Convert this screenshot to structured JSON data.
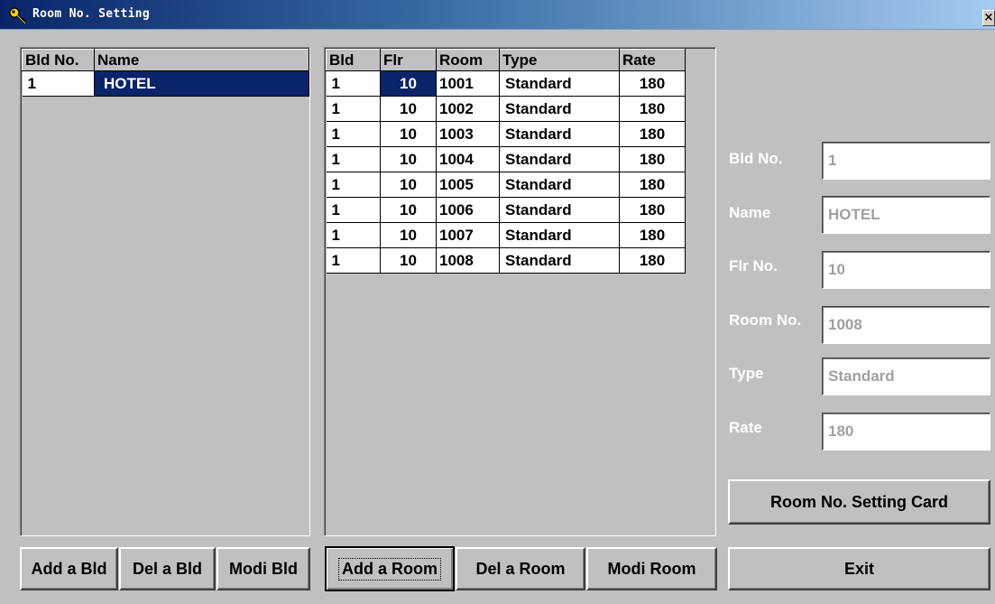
{
  "window": {
    "title": "Room No. Setting",
    "close_glyph": "×",
    "icon": "key-icon"
  },
  "buildings": {
    "columns": [
      "Bld No.",
      "Name"
    ],
    "rows": [
      {
        "bld_no": "1",
        "name": "HOTEL"
      }
    ]
  },
  "rooms": {
    "columns": [
      "Bld",
      "Flr",
      "Room",
      "Type",
      "Rate"
    ],
    "rows": [
      {
        "bld": "1",
        "flr": "10",
        "room": "1001",
        "type": "Standard",
        "rate": "180"
      },
      {
        "bld": "1",
        "flr": "10",
        "room": "1002",
        "type": "Standard",
        "rate": "180"
      },
      {
        "bld": "1",
        "flr": "10",
        "room": "1003",
        "type": "Standard",
        "rate": "180"
      },
      {
        "bld": "1",
        "flr": "10",
        "room": "1004",
        "type": "Standard",
        "rate": "180"
      },
      {
        "bld": "1",
        "flr": "10",
        "room": "1005",
        "type": "Standard",
        "rate": "180"
      },
      {
        "bld": "1",
        "flr": "10",
        "room": "1006",
        "type": "Standard",
        "rate": "180"
      },
      {
        "bld": "1",
        "flr": "10",
        "room": "1007",
        "type": "Standard",
        "rate": "180"
      },
      {
        "bld": "1",
        "flr": "10",
        "room": "1008",
        "type": "Standard",
        "rate": "180"
      }
    ]
  },
  "details": {
    "bld_no_label": "Bld No.",
    "bld_no_value": "1",
    "name_label": "Name",
    "name_value": "HOTEL",
    "flr_no_label": "Flr No.",
    "flr_no_value": "10",
    "room_no_label": "Room No.",
    "room_no_value": "1008",
    "type_label": "Type",
    "type_value": "Standard",
    "rate_label": "Rate",
    "rate_value": "180"
  },
  "buttons": {
    "add_bld": "Add a Bld",
    "del_bld": "Del a Bld",
    "modi_bld": "Modi Bld",
    "add_room": "Add a Room",
    "del_room": "Del a Room",
    "modi_room": "Modi Room",
    "setting_card": "Room No. Setting Card",
    "exit": "Exit"
  },
  "colors": {
    "selection": "#0a246a",
    "face": "#c0c0c0"
  }
}
